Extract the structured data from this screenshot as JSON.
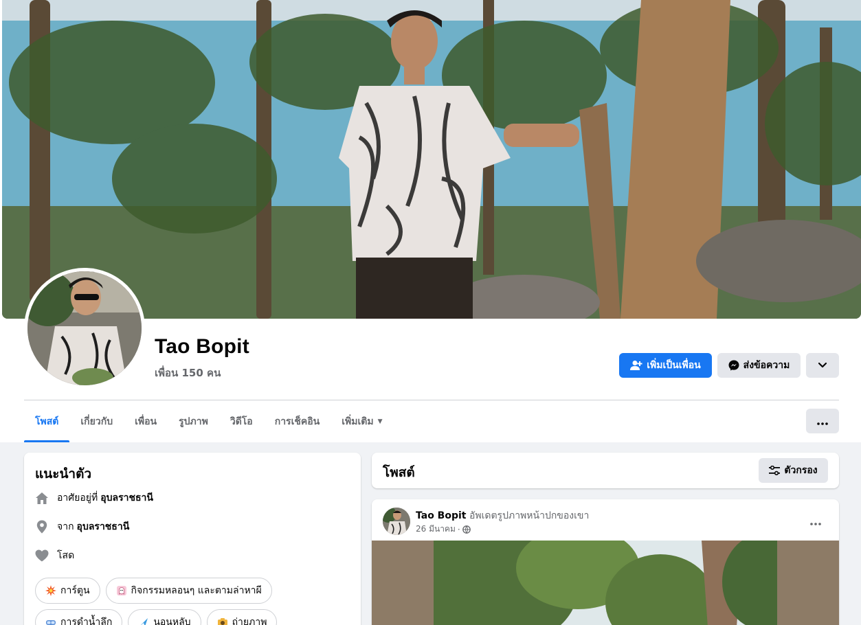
{
  "profile": {
    "name": "Tao Bopit",
    "friends": "เพื่อน 150 คน"
  },
  "actions": {
    "add_friend": "เพิ่มเป็นเพื่อน",
    "message": "ส่งข้อความ"
  },
  "tabs": [
    {
      "label": "โพสต์"
    },
    {
      "label": "เกี่ยวกับ"
    },
    {
      "label": "เพื่อน"
    },
    {
      "label": "รูปภาพ"
    },
    {
      "label": "วิดีโอ"
    },
    {
      "label": "การเช็คอิน"
    },
    {
      "label": "เพิ่มเติม"
    }
  ],
  "intro": {
    "title": "แนะนำตัว",
    "lives_prefix": "อาศัยอยู่ที่",
    "lives_value": "อุบลราชธานี",
    "from_prefix": "จาก",
    "from_value": "อุบลราชธานี",
    "relationship": "โสด",
    "hobbies": [
      {
        "label": "การ์ตูน",
        "icon": "explosion-icon"
      },
      {
        "label": "กิจกรรมหลอนๆ และตามล่าหาผี",
        "icon": "ghost-icon"
      },
      {
        "label": "การดำน้ำลึก",
        "icon": "mask-icon"
      },
      {
        "label": "นอนหลับ",
        "icon": "sleep-icon"
      },
      {
        "label": "ถ่ายภาพ",
        "icon": "camera-icon"
      }
    ]
  },
  "posts": {
    "title": "โพสต์",
    "filter_label": "ตัวกรอง"
  },
  "post": {
    "author": "Tao Bopit",
    "action": "อัพเดตรูปภาพหน้าปกของเขา",
    "date": "26 มีนาคม",
    "separator": "·"
  },
  "colors": {
    "accent": "#1877f2",
    "background": "#f0f2f5",
    "button_gray": "#e4e6eb",
    "secondary_text": "#65676b"
  }
}
